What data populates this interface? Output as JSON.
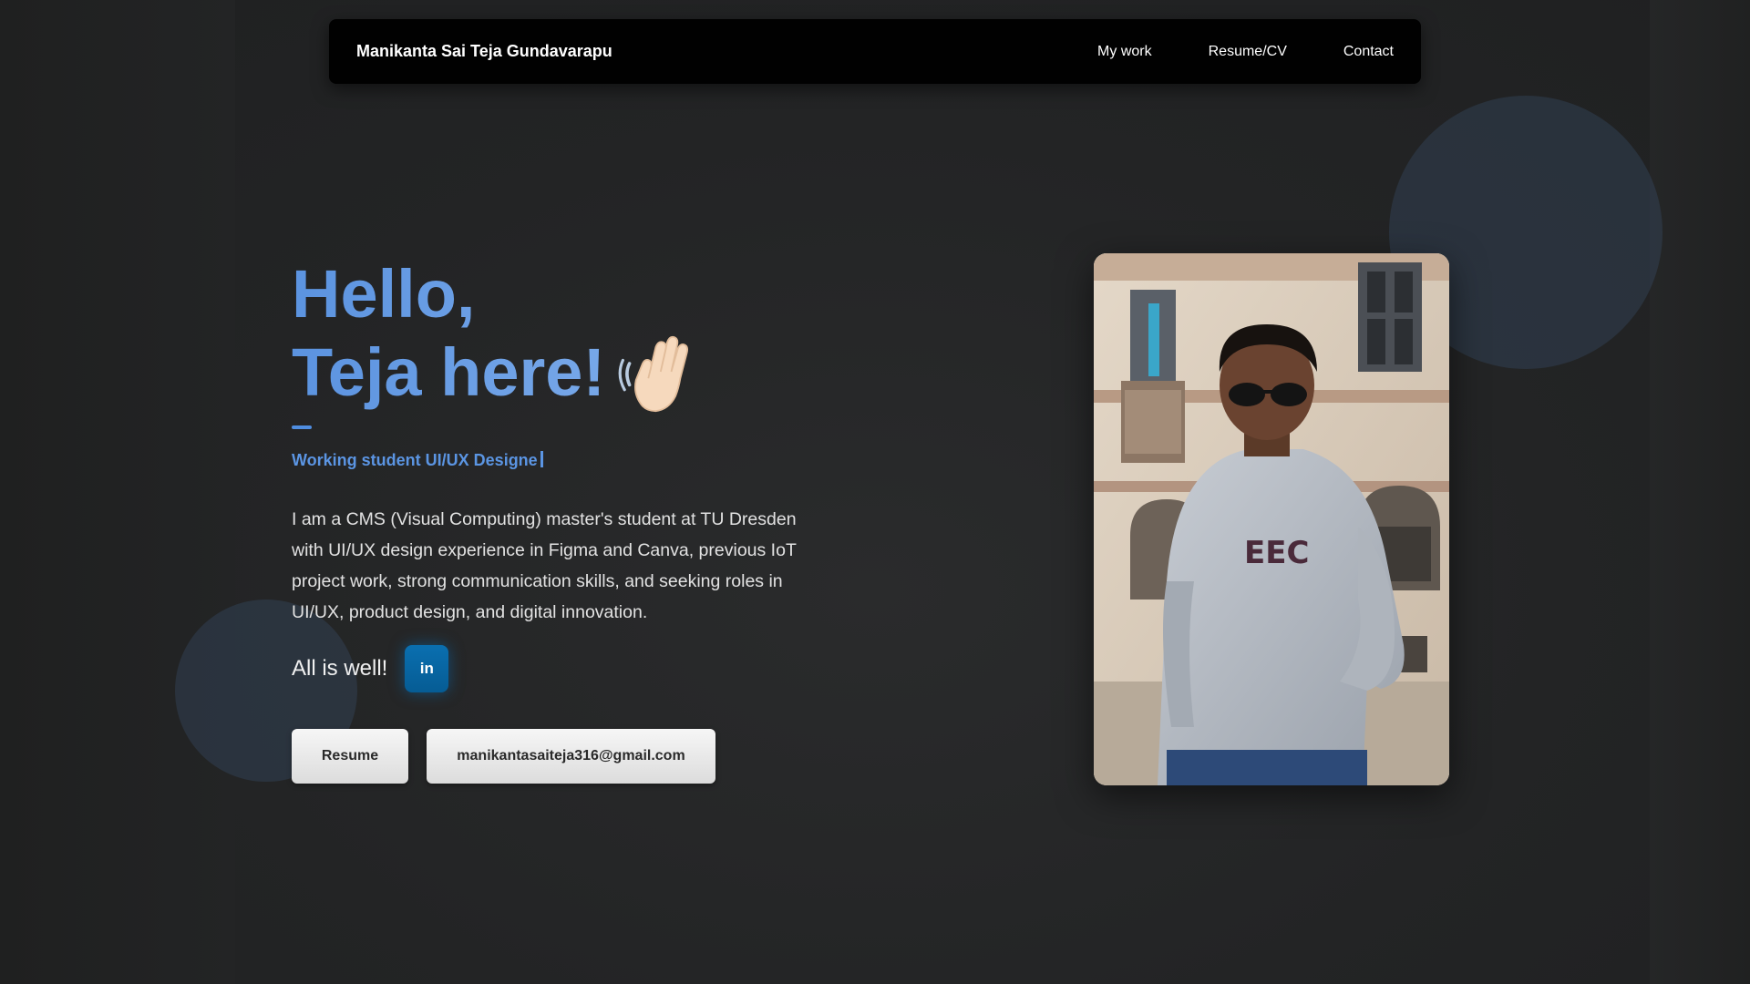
{
  "nav": {
    "brand": "Manikanta Sai Teja Gundavarapu",
    "links": [
      "My work",
      "Resume/CV",
      "Contact"
    ]
  },
  "hero": {
    "line1": "Hello,",
    "line2": "Teja here!",
    "wave_icon": "waving-hand-icon",
    "subtitle": "Working student UI/UX Designe",
    "bio": "I am a CMS (Visual Computing) master's student at TU Dresden with UI/UX design experience in Figma and Canva, previous IoT project work, strong communication skills, and seeking roles in UI/UX, product design, and digital innovation.",
    "motto": "All is well!",
    "linkedin_label": "in"
  },
  "actions": {
    "resume_label": "Resume",
    "email_label": "manikantasaiteja316@gmail.com"
  },
  "photo": {
    "shirt_text": "EEC"
  },
  "colors": {
    "accent": "#5b93e0",
    "navbar": "#010101",
    "background": "#232425",
    "linkedin": "#0a66a8"
  }
}
